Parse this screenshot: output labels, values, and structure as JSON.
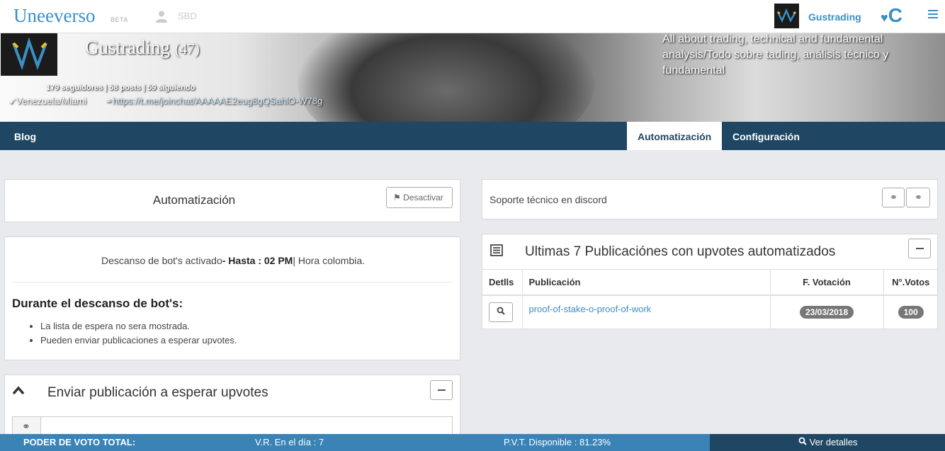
{
  "topbar": {
    "brand": "Uneeverso",
    "beta": "BETA",
    "sbd": "SBD",
    "username": "Gustrading",
    "heart_c": "C"
  },
  "cover": {
    "name": "Gustrading",
    "reputation": "(47)",
    "description": "All about trading, technical and fundamental analysis/Todo sobre tading, análisis técnico y fundamental",
    "stats": "179 seguidores | 58 posts | 59 siguiendo",
    "location": "Venezuela/Miami",
    "link": "https://t.me/joinchat/AAAAAE2eug8gQSahlO-W78g"
  },
  "tabs": {
    "blog": "Blog",
    "automatizacion": "Automatización",
    "configuracion": "Configuración"
  },
  "automation_panel": {
    "title": "Automatización",
    "deactivate_label": "Desactivar"
  },
  "rest_panel": {
    "line_prefix": "Descanso de bot's activado",
    "line_bold": "- Hasta : 02 PM",
    "line_suffix": "| Hora colombia.",
    "heading": "Durante el descanso de bot's:",
    "items": [
      "La lista de espera no sera mostrada.",
      "Pueden enviar publicaciones a esperar upvotes."
    ]
  },
  "send_panel": {
    "title": "Enviar publicación a esperar upvotes"
  },
  "discord_panel": {
    "label": "Soporte técnico en discord"
  },
  "last_panel": {
    "title": "Ultimas 7 Publicaciónes con upvotes automatizados",
    "headers": [
      "Detlls",
      "Publicación",
      "F. Votación",
      "N°.Votos"
    ],
    "rows": [
      {
        "publication": "proof-of-stake-o-proof-of-work",
        "date": "23/03/2018",
        "votes": "100"
      }
    ]
  },
  "footer": {
    "label": "PODER DE VOTO TOTAL:",
    "vr": "V.R. En el día : 7",
    "pvt": "P.V.T. Disponible : 81.23%",
    "details": "Ver detalles"
  },
  "colors": {
    "brand": "#3a8fc4",
    "navbar": "#1f4763",
    "footer": "#3a83b7",
    "badge": "#777777"
  }
}
